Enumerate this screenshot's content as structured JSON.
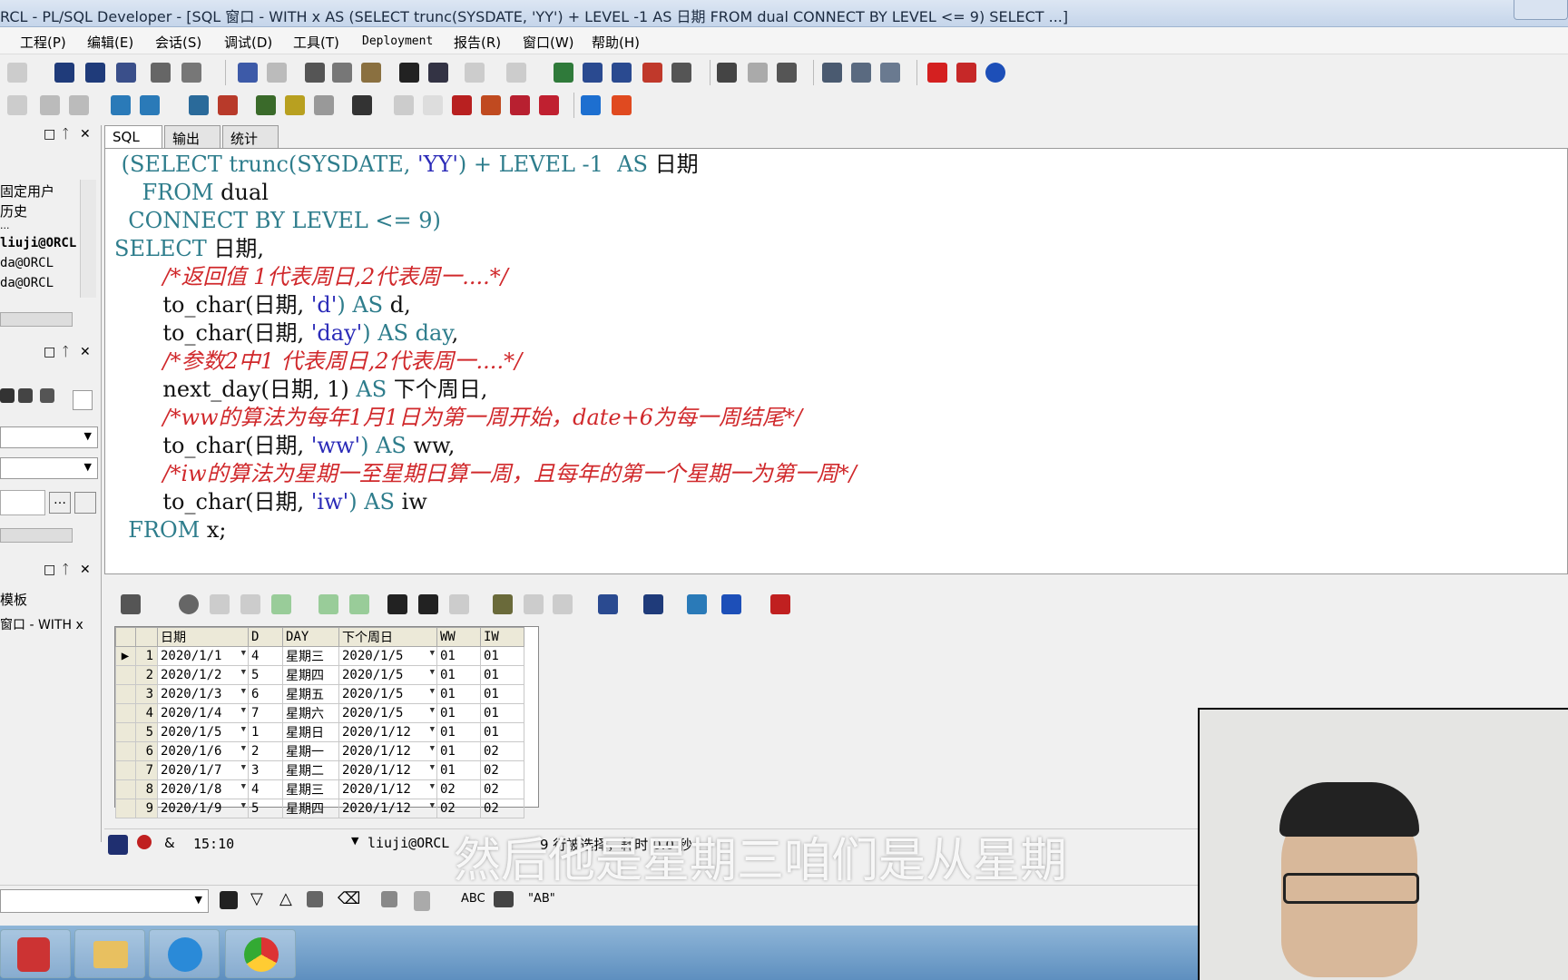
{
  "window": {
    "title": "RCL - PL/SQL Developer - [SQL 窗口 - WITH x AS (SELECT trunc(SYSDATE, 'YY') + LEVEL -1 AS 日期 FROM dual CONNECT BY LEVEL <= 9) SELECT ...]"
  },
  "menu": [
    "工程(P)",
    "编辑(E)",
    "会话(S)",
    "调试(D)",
    "工具(T)",
    "Deployment",
    "报告(R)",
    "窗口(W)",
    "帮助(H)"
  ],
  "left_pane": {
    "items": [
      "固定用户",
      "历史",
      "...",
      "liuji@ORCL",
      "da@ORCL",
      "da@ORCL"
    ],
    "templates_label": "模板",
    "window_item": "窗口 - WITH x"
  },
  "tabs": [
    "SQL",
    "输出",
    "统计"
  ],
  "editor": {
    "lines": [
      {
        "parts": [
          {
            "t": " (SELECT ",
            "c": "kw"
          },
          {
            "t": "trunc(SYSDATE, ",
            "c": "kw"
          },
          {
            "t": "'YY'",
            "c": "str"
          },
          {
            "t": ") + LEVEL -1  AS ",
            "c": "kw"
          },
          {
            "t": "日期",
            "c": "pl"
          }
        ]
      },
      {
        "parts": [
          {
            "t": "    FROM ",
            "c": "kw"
          },
          {
            "t": "dual",
            "c": "pl"
          }
        ]
      },
      {
        "parts": [
          {
            "t": "  CONNECT BY LEVEL <= 9)",
            "c": "kw"
          }
        ]
      },
      {
        "parts": [
          {
            "t": "SELECT ",
            "c": "kw"
          },
          {
            "t": "日期,",
            "c": "pl"
          }
        ]
      },
      {
        "parts": [
          {
            "t": "       /*返回值 1代表周日,2代表周一....*/",
            "c": "cm"
          }
        ]
      },
      {
        "parts": [
          {
            "t": "       to_char(日期, ",
            "c": "pl"
          },
          {
            "t": "'d'",
            "c": "str"
          },
          {
            "t": ") AS ",
            "c": "kw"
          },
          {
            "t": "d,",
            "c": "pl"
          }
        ]
      },
      {
        "parts": [
          {
            "t": "       to_char(日期, ",
            "c": "pl"
          },
          {
            "t": "'day'",
            "c": "str"
          },
          {
            "t": ") AS day",
            "c": "kw"
          },
          {
            "t": ",",
            "c": "pl"
          }
        ]
      },
      {
        "parts": [
          {
            "t": "       /*参数2中1 代表周日,2代表周一....*/",
            "c": "cm"
          }
        ]
      },
      {
        "parts": [
          {
            "t": "       next_day(日期, 1) ",
            "c": "pl"
          },
          {
            "t": "AS ",
            "c": "kw"
          },
          {
            "t": "下个周日,",
            "c": "pl"
          }
        ]
      },
      {
        "parts": [
          {
            "t": "       /*ww的算法为每年1月1日为第一周开始，date+6为每一周结尾*/",
            "c": "cm"
          }
        ]
      },
      {
        "parts": [
          {
            "t": "       to_char(日期, ",
            "c": "pl"
          },
          {
            "t": "'ww'",
            "c": "str"
          },
          {
            "t": ") AS ",
            "c": "kw"
          },
          {
            "t": "ww,",
            "c": "pl"
          }
        ]
      },
      {
        "parts": [
          {
            "t": "       /*iw的算法为星期一至星期日算一周，且每年的第一个星期一为第一周*/",
            "c": "cm"
          }
        ]
      },
      {
        "parts": [
          {
            "t": "       to_char(日期, ",
            "c": "pl"
          },
          {
            "t": "'iw'",
            "c": "str"
          },
          {
            "t": ") AS ",
            "c": "kw"
          },
          {
            "t": "iw",
            "c": "pl"
          }
        ]
      },
      {
        "parts": [
          {
            "t": "  FROM ",
            "c": "kw"
          },
          {
            "t": "x;",
            "c": "pl"
          }
        ]
      }
    ]
  },
  "grid": {
    "columns": [
      "日期",
      "D",
      "DAY",
      "下个周日",
      "WW",
      "IW"
    ],
    "rows": [
      [
        "1",
        "2020/1/1",
        "4",
        "星期三",
        "2020/1/5",
        "01",
        "01"
      ],
      [
        "2",
        "2020/1/2",
        "5",
        "星期四",
        "2020/1/5",
        "01",
        "01"
      ],
      [
        "3",
        "2020/1/3",
        "6",
        "星期五",
        "2020/1/5",
        "01",
        "01"
      ],
      [
        "4",
        "2020/1/4",
        "7",
        "星期六",
        "2020/1/5",
        "01",
        "01"
      ],
      [
        "5",
        "2020/1/5",
        "1",
        "星期日",
        "2020/1/12",
        "01",
        "01"
      ],
      [
        "6",
        "2020/1/6",
        "2",
        "星期一",
        "2020/1/12",
        "01",
        "02"
      ],
      [
        "7",
        "2020/1/7",
        "3",
        "星期二",
        "2020/1/12",
        "01",
        "02"
      ],
      [
        "8",
        "2020/1/8",
        "4",
        "星期三",
        "2020/1/12",
        "02",
        "02"
      ],
      [
        "9",
        "2020/1/9",
        "5",
        "星期四",
        "2020/1/12",
        "02",
        "02"
      ]
    ]
  },
  "status": {
    "position": "15:10",
    "connection": "liuji@ORCL",
    "message": "9 行被选择，耗时 0.0 秒"
  },
  "findbar": {
    "abc": "ABC",
    "ab": "\"AB\""
  },
  "subtitle": "然后他是星期三咱们是从星期",
  "colors": {
    "keyword": "#2e7d8c",
    "string": "#2b2bb8",
    "comment": "#d0282b"
  }
}
